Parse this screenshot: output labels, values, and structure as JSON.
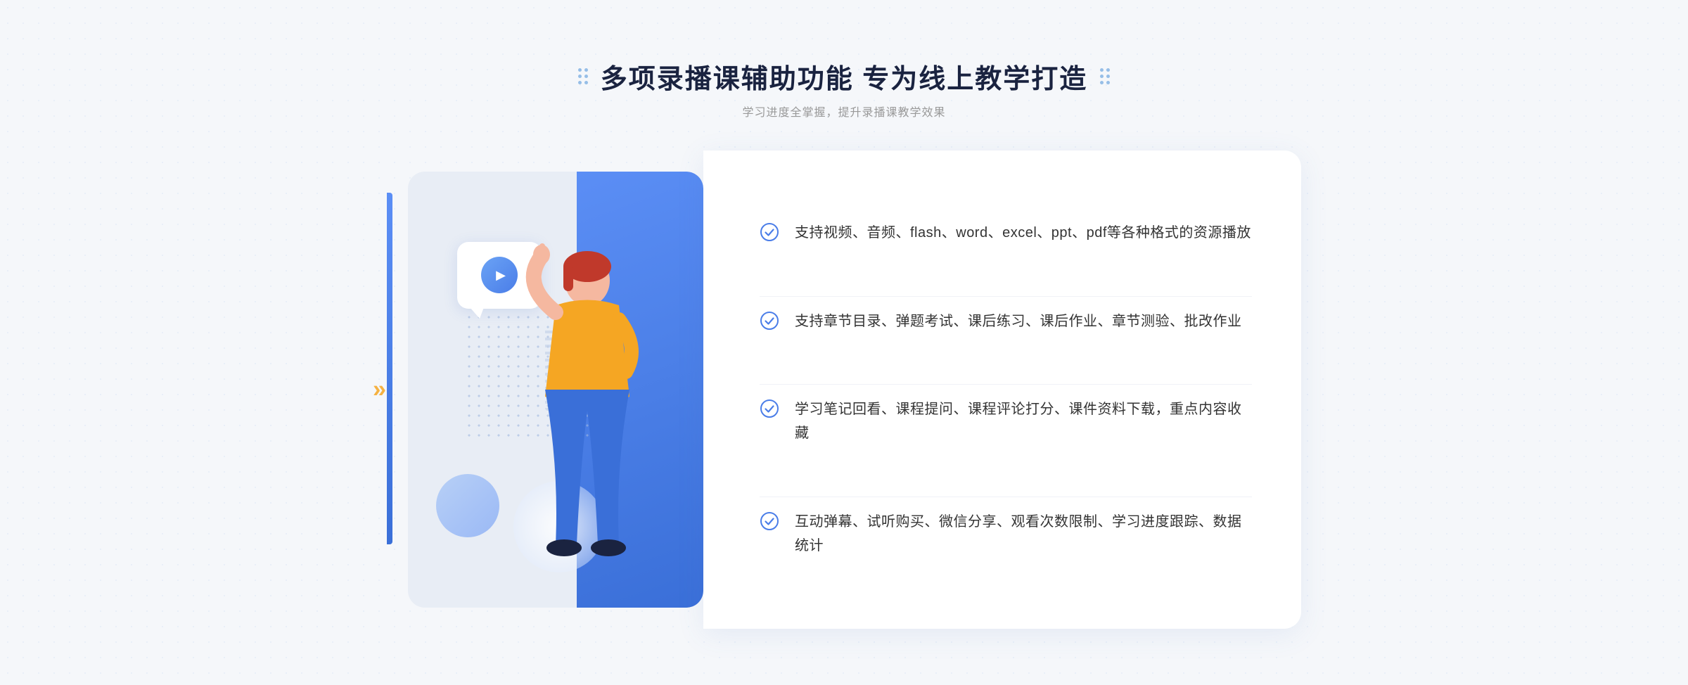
{
  "header": {
    "title": "多项录播课辅助功能 专为线上教学打造",
    "subtitle": "学习进度全掌握，提升录播课教学效果"
  },
  "features": [
    {
      "id": "feature-1",
      "text": "支持视频、音频、flash、word、excel、ppt、pdf等各种格式的资源播放"
    },
    {
      "id": "feature-2",
      "text": "支持章节目录、弹题考试、课后练习、课后作业、章节测验、批改作业"
    },
    {
      "id": "feature-3",
      "text": "学习笔记回看、课程提问、课程评论打分、课件资料下载，重点内容收藏"
    },
    {
      "id": "feature-4",
      "text": "互动弹幕、试听购买、微信分享、观看次数限制、学习进度跟踪、数据统计"
    }
  ],
  "icons": {
    "check": "check-circle-icon",
    "play": "play-icon",
    "chevron": "chevron-icon"
  },
  "colors": {
    "accent_blue": "#4a7de8",
    "light_blue": "#5b8ef5",
    "title_dark": "#1a2340",
    "text_gray": "#999999",
    "feature_text": "#333333"
  }
}
